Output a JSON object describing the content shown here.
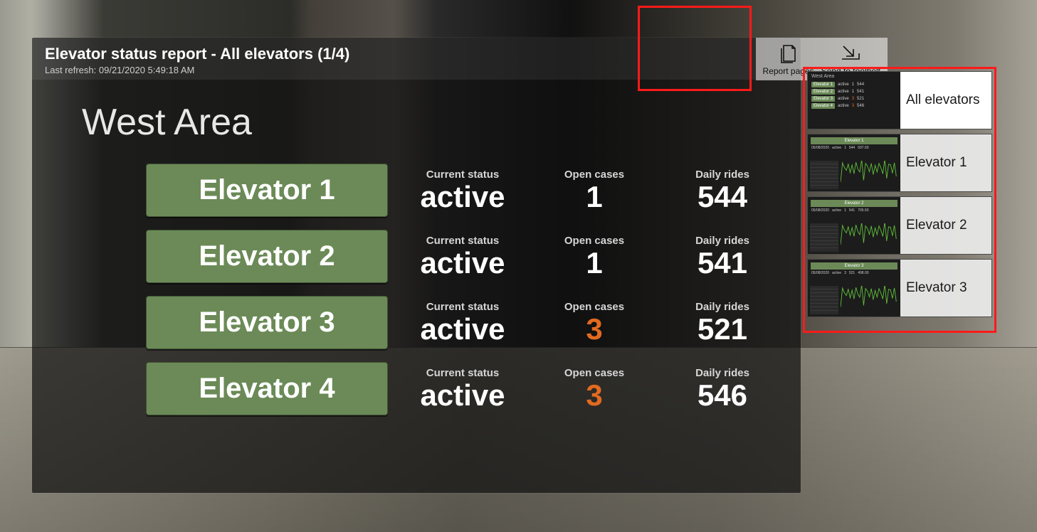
{
  "header": {
    "title": "Elevator status report - All elevators (1/4)",
    "refresh_prefix": "Last refresh: ",
    "refresh_time": "09/21/2020 5:49:18 AM"
  },
  "toolbar": {
    "report_pages": "Report pages",
    "send_toolbelt": "Send to toolbelt"
  },
  "area_title": "West Area",
  "labels": {
    "current_status": "Current status",
    "open_cases": "Open cases",
    "daily_rides": "Daily rides"
  },
  "colors": {
    "accent_green": "#6b8a57",
    "warn_orange": "#e26a1f",
    "highlight_red": "#ff1a1a"
  },
  "elevators": [
    {
      "name": "Elevator 1",
      "status": "active",
      "open_cases": "1",
      "cases_warn": false,
      "daily_rides": "544"
    },
    {
      "name": "Elevator 2",
      "status": "active",
      "open_cases": "1",
      "cases_warn": false,
      "daily_rides": "541"
    },
    {
      "name": "Elevator 3",
      "status": "active",
      "open_cases": "3",
      "cases_warn": true,
      "daily_rides": "521"
    },
    {
      "name": "Elevator 4",
      "status": "active",
      "open_cases": "3",
      "cases_warn": true,
      "daily_rides": "546"
    }
  ],
  "thumbs": [
    {
      "kind": "summary",
      "label": "All elevators",
      "active": true,
      "mini_title": "West Area",
      "rows": [
        {
          "name": "Elevator 1",
          "status": "active",
          "cases": "1",
          "rides": "544",
          "warn": false
        },
        {
          "name": "Elevator 2",
          "status": "active",
          "cases": "1",
          "rides": "541",
          "warn": false
        },
        {
          "name": "Elevator 3",
          "status": "active",
          "cases": "3",
          "rides": "521",
          "warn": true
        },
        {
          "name": "Elevator 4",
          "status": "active",
          "cases": "3",
          "rides": "546",
          "warn": true
        }
      ]
    },
    {
      "kind": "chart",
      "label": "Elevator 1",
      "active": false,
      "mini_head": "Elevator 1",
      "stats": {
        "date": "05/08/2020",
        "status": "active",
        "cases": "1",
        "rides": "544",
        "extra": "597.60"
      }
    },
    {
      "kind": "chart",
      "label": "Elevator 2",
      "active": false,
      "mini_head": "Elevator 2",
      "stats": {
        "date": "05/08/2020",
        "status": "active",
        "cases": "1",
        "rides": "541",
        "extra": "705.50"
      }
    },
    {
      "kind": "chart",
      "label": "Elevator 3",
      "active": false,
      "mini_head": "Elevator 3",
      "stats": {
        "date": "05/08/2020",
        "status": "active",
        "cases": "3",
        "rides": "521",
        "extra": "498.00"
      }
    }
  ]
}
